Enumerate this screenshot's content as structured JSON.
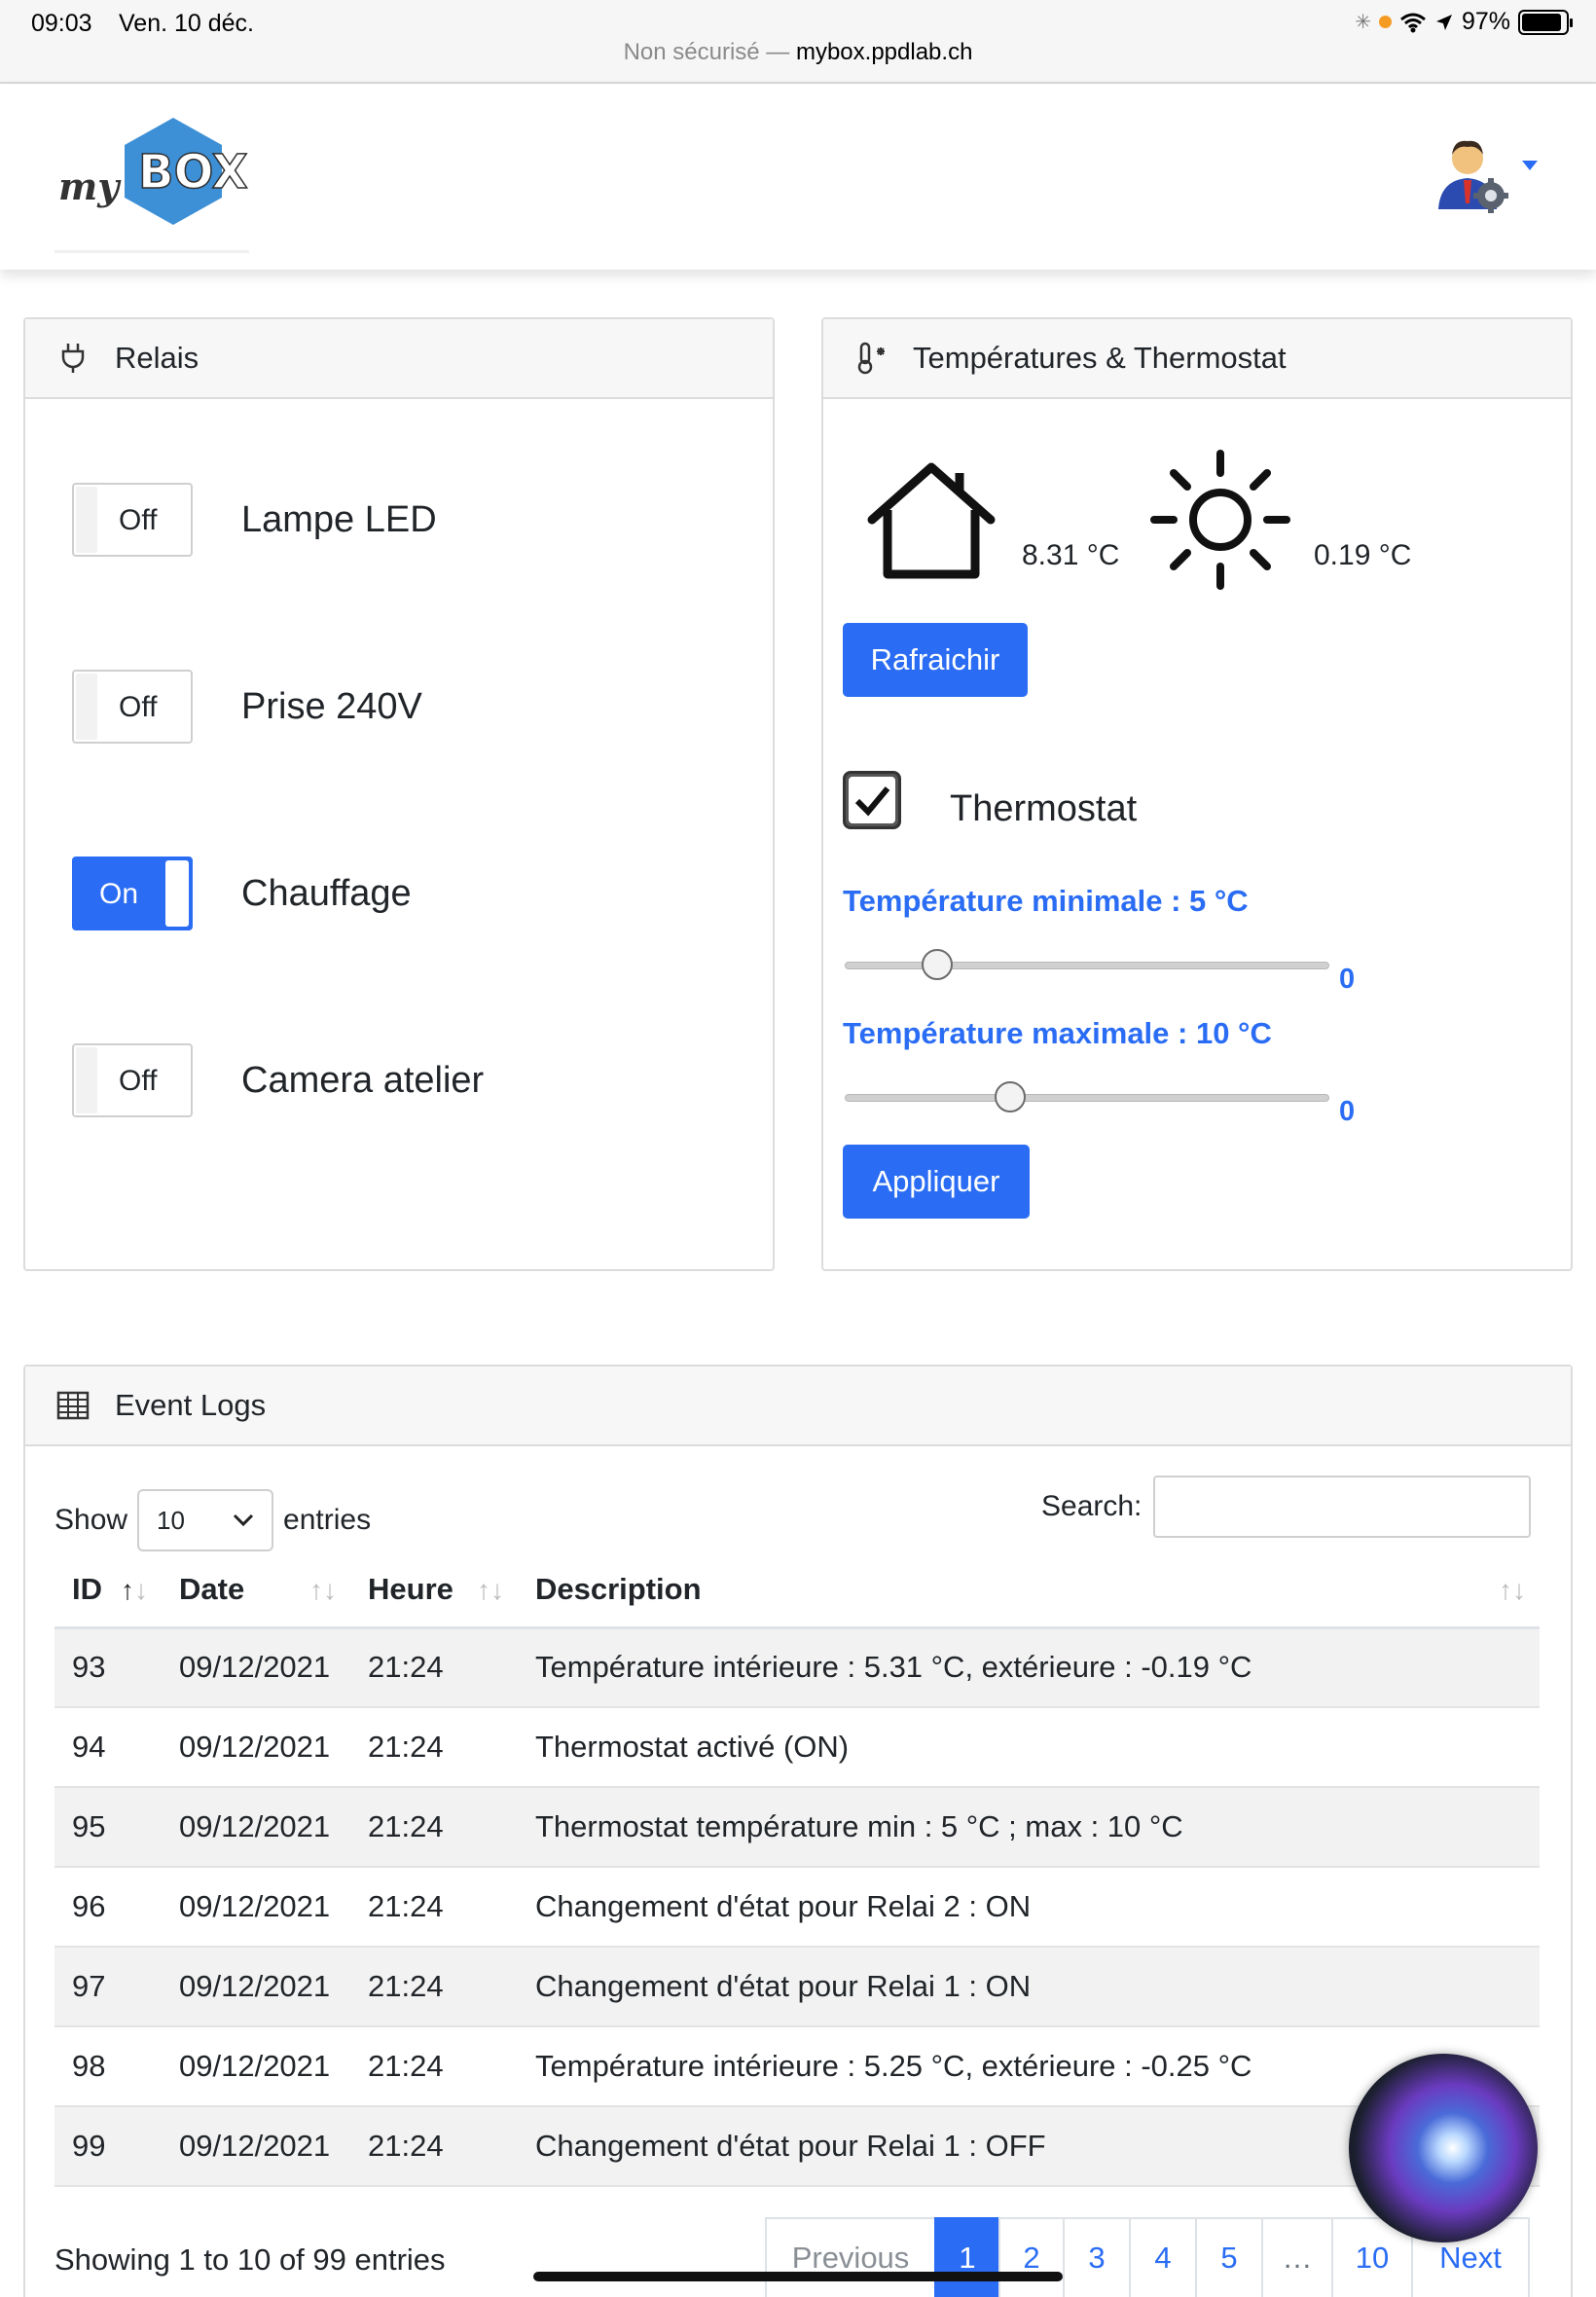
{
  "statusbar": {
    "time": "09:03",
    "date": "Ven. 10 déc.",
    "url_prefix": "Non sécurisé — ",
    "url_domain": "mybox.ppdlab.ch",
    "battery": "97%"
  },
  "logo": {
    "text_my": "my",
    "text_box": "BOX"
  },
  "relais": {
    "title": "Relais",
    "items": [
      {
        "label": "Lampe LED",
        "state": "Off"
      },
      {
        "label": "Prise 240V",
        "state": "Off"
      },
      {
        "label": "Chauffage",
        "state": "On"
      },
      {
        "label": "Camera atelier",
        "state": "Off"
      }
    ]
  },
  "temperatures": {
    "title": "Températures & Thermostat",
    "indoor": "8.31 °C",
    "outdoor": "0.19 °C",
    "refresh_label": "Rafraichir",
    "thermostat_label": "Thermostat",
    "thermostat_checked": true,
    "min_label": "Température minimale : 5 °C",
    "min_value_display": "0",
    "min_slider_fraction": 0.19,
    "max_label": "Température maximale : 10 °C",
    "max_value_display": "0",
    "max_slider_fraction": 0.34,
    "apply_label": "Appliquer"
  },
  "logs": {
    "title": "Event Logs",
    "show_label": "Show",
    "entries_label": "entries",
    "page_size": "10",
    "search_label": "Search:",
    "columns": [
      "ID",
      "Date",
      "Heure",
      "Description"
    ],
    "rows": [
      [
        "93",
        "09/12/2021",
        "21:24",
        "Température intérieure : 5.31 °C, extérieure : -0.19 °C"
      ],
      [
        "94",
        "09/12/2021",
        "21:24",
        "Thermostat activé (ON)"
      ],
      [
        "95",
        "09/12/2021",
        "21:24",
        "Thermostat température min : 5 °C ; max : 10 °C"
      ],
      [
        "96",
        "09/12/2021",
        "21:24",
        "Changement d'état pour Relai 2 : ON"
      ],
      [
        "97",
        "09/12/2021",
        "21:24",
        "Changement d'état pour Relai 1 : ON"
      ],
      [
        "98",
        "09/12/2021",
        "21:24",
        "Température intérieure : 5.25 °C, extérieure : -0.25 °C"
      ],
      [
        "99",
        "09/12/2021",
        "21:24",
        "Changement d'état pour Relai 1 : OFF"
      ]
    ],
    "info": "Showing 1 to 10 of 99 entries",
    "pagination": {
      "previous": "Previous",
      "pages": [
        "1",
        "2",
        "3",
        "4",
        "5"
      ],
      "ellipsis": "…",
      "last": "10",
      "next": "Next",
      "active": "1"
    }
  },
  "colors": {
    "primary": "#2a6df4",
    "logo_blue": "#3d8fd6",
    "header_bg": "#f7f7f7"
  }
}
